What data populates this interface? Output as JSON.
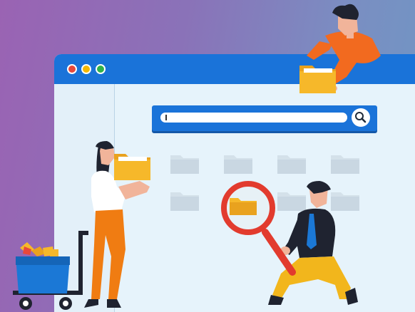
{
  "illustration": {
    "theme": "file-search",
    "colors": {
      "background_start": "#9a63b3",
      "background_end": "#6f97c4",
      "browser_bar": "#1a73d9",
      "browser_body": "#e6f3fb",
      "dot_red": "#e8483b",
      "dot_yellow": "#f5b800",
      "dot_green": "#2fb24a",
      "folder": "#f6b82a",
      "magnifier_ring": "#e23b2e",
      "cart": "#1b78d6",
      "woman_pants": "#f07c12",
      "man_pants": "#f2b61c",
      "top_shirt": "#f26a1f"
    },
    "icons": [
      "search-icon",
      "folder-icon",
      "magnifier-icon",
      "cart-icon"
    ]
  }
}
